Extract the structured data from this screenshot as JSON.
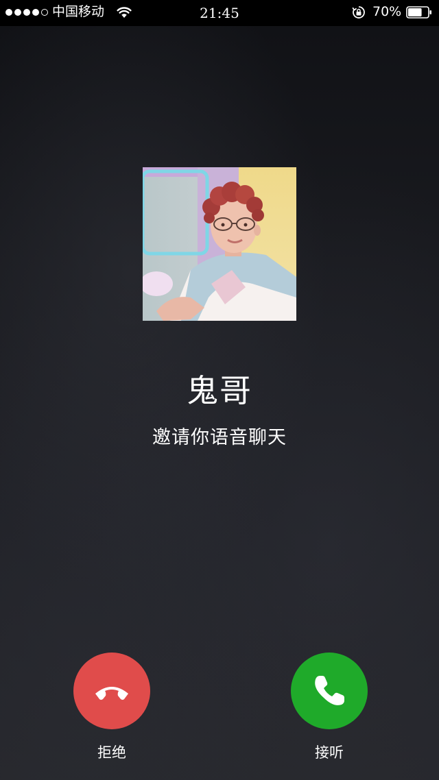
{
  "status_bar": {
    "carrier": "中国移动",
    "time": "21:45",
    "battery_percent": "70%",
    "battery_level": 0.7,
    "signal_bars_filled": 4,
    "signal_bars_total": 5,
    "icons": [
      "wifi-icon",
      "rotation-lock-icon",
      "battery-icon"
    ]
  },
  "caller": {
    "name": "鬼哥",
    "subtitle": "邀请你语音聊天",
    "avatar_icon": "caller-avatar-photo"
  },
  "actions": {
    "decline": {
      "label": "拒绝",
      "icon": "hang-up-icon",
      "color": "#e04c4b"
    },
    "accept": {
      "label": "接听",
      "icon": "phone-icon",
      "color": "#1faa2a"
    }
  },
  "colors": {
    "background": "#1b1c20",
    "text": "#ffffff"
  }
}
